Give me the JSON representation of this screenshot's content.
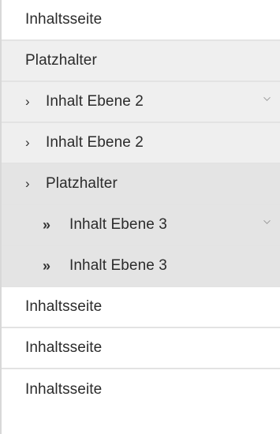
{
  "nav": {
    "items": [
      {
        "label": "Inhaltsseite"
      },
      {
        "label": "Platzhalter"
      },
      {
        "marker": "›",
        "label": "Inhalt Ebene 2",
        "expandable": true
      },
      {
        "marker": "›",
        "label": "Inhalt Ebene 2"
      },
      {
        "marker": "›",
        "label": "Platzhalter"
      },
      {
        "marker": "»",
        "label": "Inhalt Ebene 3",
        "expandable": true
      },
      {
        "marker": "»",
        "label": "Inhalt Ebene 3"
      },
      {
        "label": "Inhaltsseite"
      },
      {
        "label": "Inhaltsseite"
      },
      {
        "label": "Inhaltsseite"
      }
    ],
    "icons": {
      "expand": "chevron-down-icon"
    },
    "colors": {
      "row_white": "#ffffff",
      "row_light": "#efefef",
      "row_selected": "#e4e4e4",
      "divider": "#e3e3e3",
      "text": "#2b2b2b"
    }
  }
}
